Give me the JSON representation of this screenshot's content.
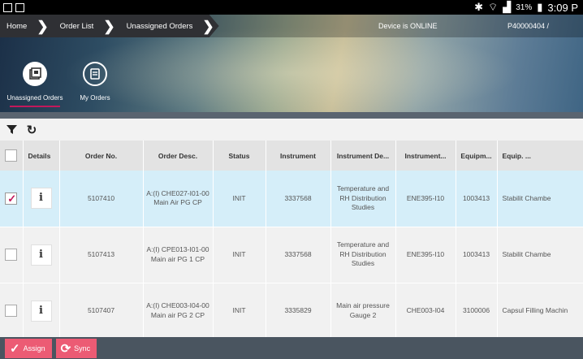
{
  "status_bar": {
    "bluetooth_icon": "bluetooth-icon",
    "wifi_icon": "wifi-icon",
    "signal_icon": "signal-icon",
    "battery": "31%",
    "time": "3:09 P"
  },
  "breadcrumb": {
    "items": [
      "Home",
      "Order List",
      "Unassigned Orders"
    ]
  },
  "device_status": "Device is ONLINE",
  "user_id": "P40000404 /",
  "tabs": [
    {
      "label": "Unassigned Orders",
      "icon": "unassigned-orders-icon",
      "active": true
    },
    {
      "label": "My Orders",
      "icon": "my-orders-icon",
      "active": false
    }
  ],
  "toolbar": {
    "filter_icon": "filter-icon",
    "refresh_icon": "refresh-icon"
  },
  "table": {
    "headers": [
      "",
      "Details",
      "Order No.",
      "Order Desc.",
      "Status",
      "Instrument",
      "Instrument De...",
      "Instrument...",
      "Equipm...",
      "Equip. ..."
    ],
    "rows": [
      {
        "checked": true,
        "details": "i",
        "order_no": "5107410",
        "order_desc": "A:(I) CHE027-I01-00 Main Air PG CP",
        "status": "INIT",
        "instrument": "3337568",
        "instrument_desc": "Temperature and RH Distribution Studies",
        "instrument_id": "ENE395-I10",
        "equipment": "1003413",
        "equip_desc": "Stabilit Chambe"
      },
      {
        "checked": false,
        "details": "i",
        "order_no": "5107413",
        "order_desc": "A:(I) CPE013-I01-00 Main air PG 1 CP",
        "status": "INIT",
        "instrument": "3337568",
        "instrument_desc": "Temperature and RH Distribution Studies",
        "instrument_id": "ENE395-I10",
        "equipment": "1003413",
        "equip_desc": "Stabilit Chambe"
      },
      {
        "checked": false,
        "details": "i",
        "order_no": "5107407",
        "order_desc": "A:(I) CHE003-I04-00 Main air PG 2 CP",
        "status": "INIT",
        "instrument": "3335829",
        "instrument_desc": "Main air pressure Gauge 2",
        "instrument_id": "CHE003-I04",
        "equipment": "3100006",
        "equip_desc": "Capsul Filling Machin"
      }
    ]
  },
  "actions": {
    "assign": "Assign",
    "sync": "Sync"
  },
  "colors": {
    "accent": "#ec5b74",
    "selected_row": "#d5eef9",
    "header_bg": "#e3e3e3"
  }
}
